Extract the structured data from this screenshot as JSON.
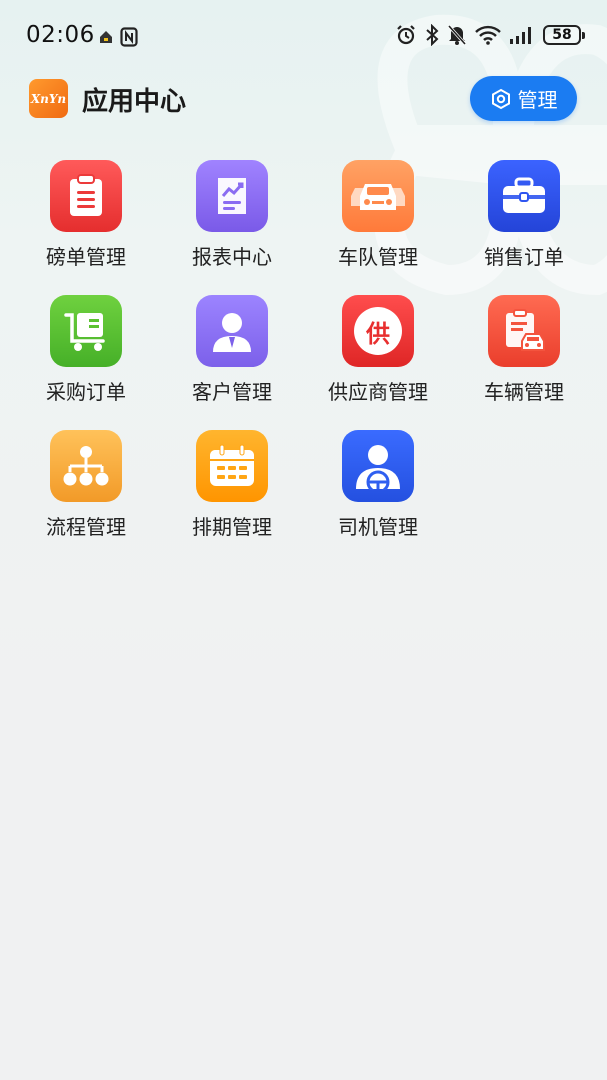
{
  "status_bar": {
    "time": "02:06",
    "battery": "58",
    "icons": [
      "home-notification-icon",
      "nfc-icon",
      "alarm-icon",
      "bluetooth-icon",
      "mute-icon",
      "wifi-icon",
      "signal-icon",
      "battery-icon"
    ]
  },
  "header": {
    "logo_text": "XnYn",
    "title": "应用中心",
    "manage_label": "管理"
  },
  "apps": [
    {
      "label": "磅单管理",
      "icon": "clipboard-icon",
      "color": "#ef3b3b"
    },
    {
      "label": "报表中心",
      "icon": "report-chart-icon",
      "color": "#8c6cf2"
    },
    {
      "label": "车队管理",
      "icon": "fleet-cars-icon",
      "color": "#ff8a4c"
    },
    {
      "label": "销售订单",
      "icon": "briefcase-icon",
      "color": "#2f55f0"
    },
    {
      "label": "采购订单",
      "icon": "cart-icon",
      "color": "#5cc231"
    },
    {
      "label": "客户管理",
      "icon": "customer-icon",
      "color": "#8a6cf2"
    },
    {
      "label": "供应商管理",
      "icon": "supplier-icon",
      "color": "#f23b3b"
    },
    {
      "label": "车辆管理",
      "icon": "vehicle-doc-icon",
      "color": "#f4543e"
    },
    {
      "label": "流程管理",
      "icon": "flowchart-icon",
      "color": "#f7ad3c"
    },
    {
      "label": "排期管理",
      "icon": "calendar-icon",
      "color": "#ffa514"
    },
    {
      "label": "司机管理",
      "icon": "driver-icon",
      "color": "#2f5ff0"
    }
  ],
  "icon_texts": {
    "supplier_char": "供"
  }
}
